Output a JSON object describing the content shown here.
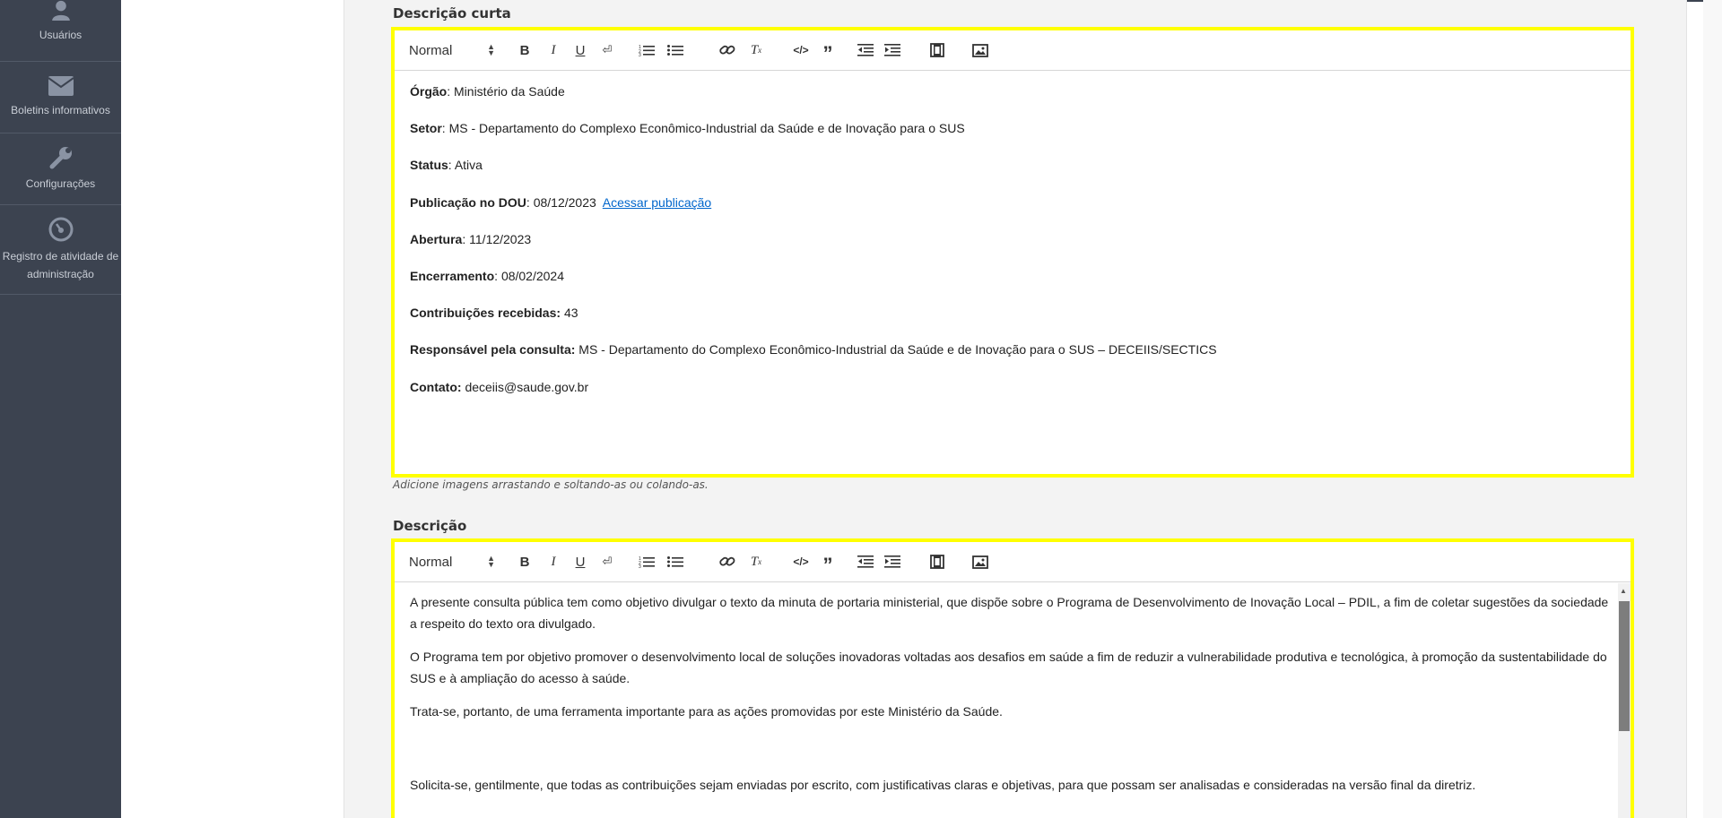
{
  "sidebar": {
    "items": [
      {
        "label": "Usuários",
        "icon": "user-icon"
      },
      {
        "label": "Boletins informativos",
        "icon": "envelope-icon"
      },
      {
        "label": "Configurações",
        "icon": "wrench-icon"
      },
      {
        "label": "Registro de atividade de administração",
        "icon": "dashboard-icon"
      }
    ]
  },
  "short_description": {
    "label": "Descrição curta",
    "hint": "Adicione imagens arrastando e soltando-as ou colando-as.",
    "format_select": "Normal",
    "fields": [
      {
        "key": "Órgão",
        "sep": ":",
        "value": "Ministério da Saúde"
      },
      {
        "key": "Setor",
        "sep": ":",
        "value": "MS - Departamento do Complexo Econômico-Industrial da Saúde e de Inovação para o SUS"
      },
      {
        "key": "Status",
        "sep": ":",
        "value": "Ativa"
      },
      {
        "key": "Publicação no DOU",
        "sep": ":",
        "value": "08/12/2023",
        "link": "Acessar publicação"
      },
      {
        "key": "Abertura",
        "sep": ":",
        "value": "11/12/2023"
      },
      {
        "key": "Encerramento",
        "sep": ":",
        "value": "08/02/2024"
      },
      {
        "key": "Contribuições recebidas:",
        "sep": "",
        "value": "43"
      },
      {
        "key": "Responsável pela consulta:",
        "sep": "",
        "value": "MS - Departamento do Complexo Econômico-Industrial da Saúde e de Inovação para o SUS – DECEIIS/SECTICS"
      },
      {
        "key": "Contato:",
        "sep": "",
        "value": "deceiis@saude.gov.br"
      }
    ]
  },
  "description": {
    "label": "Descrição",
    "format_select": "Normal",
    "paragraphs": [
      "A presente consulta pública tem como objetivo divulgar o texto da minuta de portaria ministerial, que dispõe sobre o Programa de Desenvolvimento de Inovação Local – PDIL, a fim de coletar sugestões da sociedade a respeito do texto ora divulgado.",
      "O Programa tem por objetivo promover o desenvolvimento local de soluções inovadoras voltadas aos desafios em saúde a fim de reduzir a vulnerabilidade produtiva e tecnológica, à promoção da sustentabilidade do SUS e à ampliação do acesso à saúde.",
      "Trata-se, portanto, de uma ferramenta importante para as ações promovidas por este Ministério da Saúde.",
      "Solicita-se, gentilmente, que todas as contribuições sejam enviadas por escrito, com justificativas claras e objetivas, para que possam ser analisadas e consideradas na versão final da diretriz."
    ]
  },
  "toolbar_icons": [
    "bold-icon",
    "italic-icon",
    "underline-icon",
    "strike-icon",
    "ordered-list-icon",
    "bullet-list-icon",
    "link-icon",
    "clear-format-icon",
    "code-icon",
    "blockquote-icon",
    "outdent-icon",
    "indent-icon",
    "video-icon",
    "image-icon"
  ],
  "colors": {
    "sidebar": "#3c4350",
    "highlight": "#ffff00",
    "link": "#0066cc"
  }
}
